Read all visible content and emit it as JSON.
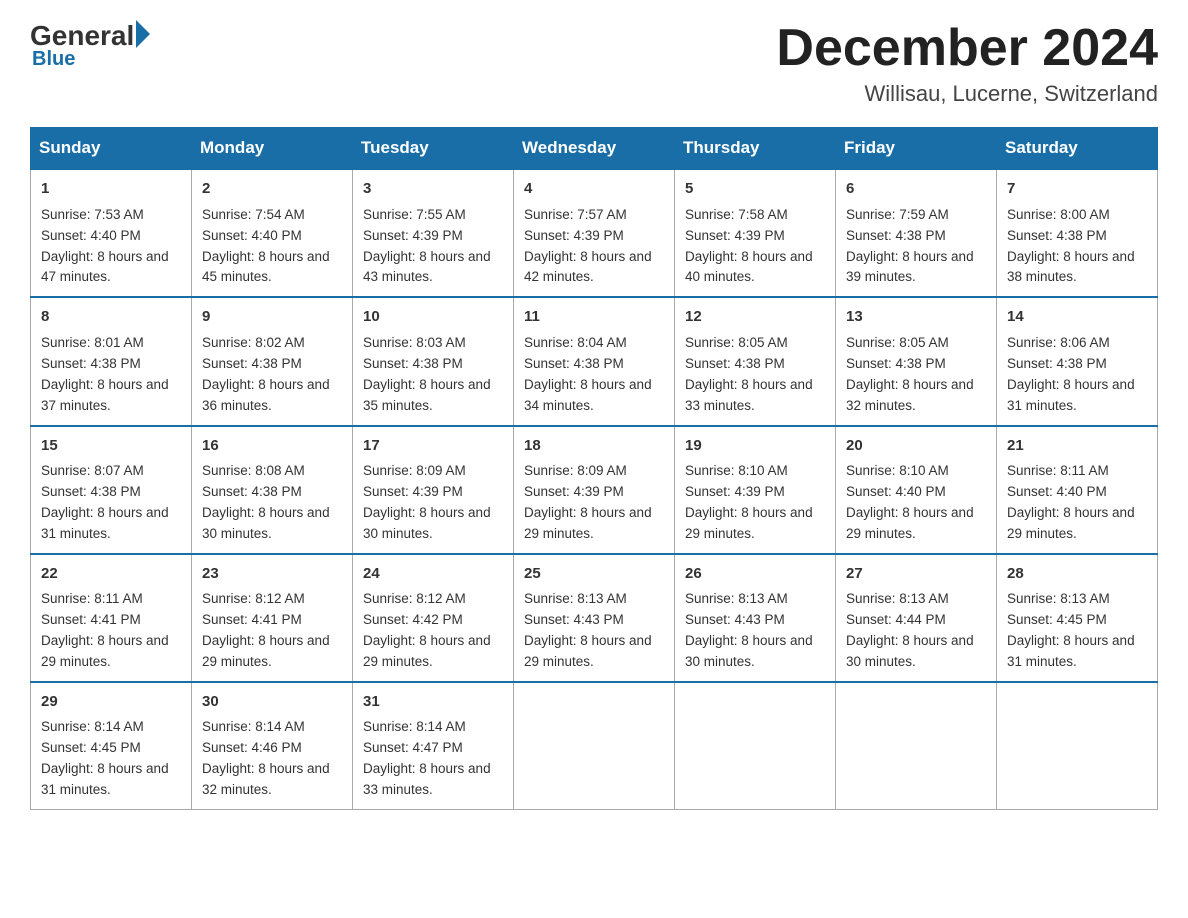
{
  "header": {
    "logo_general": "General",
    "logo_blue": "Blue",
    "month_title": "December 2024",
    "location": "Willisau, Lucerne, Switzerland"
  },
  "days_of_week": [
    "Sunday",
    "Monday",
    "Tuesday",
    "Wednesday",
    "Thursday",
    "Friday",
    "Saturday"
  ],
  "weeks": [
    [
      {
        "day": "1",
        "sunrise": "7:53 AM",
        "sunset": "4:40 PM",
        "daylight": "8 hours and 47 minutes."
      },
      {
        "day": "2",
        "sunrise": "7:54 AM",
        "sunset": "4:40 PM",
        "daylight": "8 hours and 45 minutes."
      },
      {
        "day": "3",
        "sunrise": "7:55 AM",
        "sunset": "4:39 PM",
        "daylight": "8 hours and 43 minutes."
      },
      {
        "day": "4",
        "sunrise": "7:57 AM",
        "sunset": "4:39 PM",
        "daylight": "8 hours and 42 minutes."
      },
      {
        "day": "5",
        "sunrise": "7:58 AM",
        "sunset": "4:39 PM",
        "daylight": "8 hours and 40 minutes."
      },
      {
        "day": "6",
        "sunrise": "7:59 AM",
        "sunset": "4:38 PM",
        "daylight": "8 hours and 39 minutes."
      },
      {
        "day": "7",
        "sunrise": "8:00 AM",
        "sunset": "4:38 PM",
        "daylight": "8 hours and 38 minutes."
      }
    ],
    [
      {
        "day": "8",
        "sunrise": "8:01 AM",
        "sunset": "4:38 PM",
        "daylight": "8 hours and 37 minutes."
      },
      {
        "day": "9",
        "sunrise": "8:02 AM",
        "sunset": "4:38 PM",
        "daylight": "8 hours and 36 minutes."
      },
      {
        "day": "10",
        "sunrise": "8:03 AM",
        "sunset": "4:38 PM",
        "daylight": "8 hours and 35 minutes."
      },
      {
        "day": "11",
        "sunrise": "8:04 AM",
        "sunset": "4:38 PM",
        "daylight": "8 hours and 34 minutes."
      },
      {
        "day": "12",
        "sunrise": "8:05 AM",
        "sunset": "4:38 PM",
        "daylight": "8 hours and 33 minutes."
      },
      {
        "day": "13",
        "sunrise": "8:05 AM",
        "sunset": "4:38 PM",
        "daylight": "8 hours and 32 minutes."
      },
      {
        "day": "14",
        "sunrise": "8:06 AM",
        "sunset": "4:38 PM",
        "daylight": "8 hours and 31 minutes."
      }
    ],
    [
      {
        "day": "15",
        "sunrise": "8:07 AM",
        "sunset": "4:38 PM",
        "daylight": "8 hours and 31 minutes."
      },
      {
        "day": "16",
        "sunrise": "8:08 AM",
        "sunset": "4:38 PM",
        "daylight": "8 hours and 30 minutes."
      },
      {
        "day": "17",
        "sunrise": "8:09 AM",
        "sunset": "4:39 PM",
        "daylight": "8 hours and 30 minutes."
      },
      {
        "day": "18",
        "sunrise": "8:09 AM",
        "sunset": "4:39 PM",
        "daylight": "8 hours and 29 minutes."
      },
      {
        "day": "19",
        "sunrise": "8:10 AM",
        "sunset": "4:39 PM",
        "daylight": "8 hours and 29 minutes."
      },
      {
        "day": "20",
        "sunrise": "8:10 AM",
        "sunset": "4:40 PM",
        "daylight": "8 hours and 29 minutes."
      },
      {
        "day": "21",
        "sunrise": "8:11 AM",
        "sunset": "4:40 PM",
        "daylight": "8 hours and 29 minutes."
      }
    ],
    [
      {
        "day": "22",
        "sunrise": "8:11 AM",
        "sunset": "4:41 PM",
        "daylight": "8 hours and 29 minutes."
      },
      {
        "day": "23",
        "sunrise": "8:12 AM",
        "sunset": "4:41 PM",
        "daylight": "8 hours and 29 minutes."
      },
      {
        "day": "24",
        "sunrise": "8:12 AM",
        "sunset": "4:42 PM",
        "daylight": "8 hours and 29 minutes."
      },
      {
        "day": "25",
        "sunrise": "8:13 AM",
        "sunset": "4:43 PM",
        "daylight": "8 hours and 29 minutes."
      },
      {
        "day": "26",
        "sunrise": "8:13 AM",
        "sunset": "4:43 PM",
        "daylight": "8 hours and 30 minutes."
      },
      {
        "day": "27",
        "sunrise": "8:13 AM",
        "sunset": "4:44 PM",
        "daylight": "8 hours and 30 minutes."
      },
      {
        "day": "28",
        "sunrise": "8:13 AM",
        "sunset": "4:45 PM",
        "daylight": "8 hours and 31 minutes."
      }
    ],
    [
      {
        "day": "29",
        "sunrise": "8:14 AM",
        "sunset": "4:45 PM",
        "daylight": "8 hours and 31 minutes."
      },
      {
        "day": "30",
        "sunrise": "8:14 AM",
        "sunset": "4:46 PM",
        "daylight": "8 hours and 32 minutes."
      },
      {
        "day": "31",
        "sunrise": "8:14 AM",
        "sunset": "4:47 PM",
        "daylight": "8 hours and 33 minutes."
      },
      null,
      null,
      null,
      null
    ]
  ]
}
